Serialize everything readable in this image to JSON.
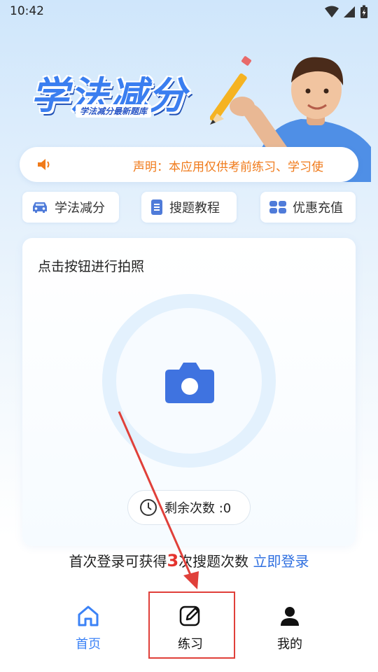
{
  "status_bar": {
    "time": "10:42"
  },
  "hero": {
    "title": "学法减分",
    "subtitle": "学法减分最新题库"
  },
  "notice": {
    "text": "声明：本应用仅供考前练习、学习使"
  },
  "quick_actions": [
    {
      "label": "学法减分",
      "icon": "car-icon"
    },
    {
      "label": "搜题教程",
      "icon": "document-icon"
    },
    {
      "label": "优惠充值",
      "icon": "coupon-icon"
    }
  ],
  "camera_card": {
    "title": "点击按钮进行拍照"
  },
  "remaining": {
    "label": "剩余次数 :0"
  },
  "login_hint": {
    "prefix": "首次登录可获得",
    "count": "3",
    "suffix": "次搜题次数",
    "link": "立即登录"
  },
  "tabbar": {
    "tabs": [
      {
        "label": "首页",
        "active": true
      },
      {
        "label": "练习",
        "active": false
      },
      {
        "label": "我的",
        "active": false
      }
    ]
  },
  "colors": {
    "accent": "#3b82f6",
    "notice_text": "#f07a1a",
    "highlight": "#e4332e",
    "link": "#2f6fe0"
  }
}
